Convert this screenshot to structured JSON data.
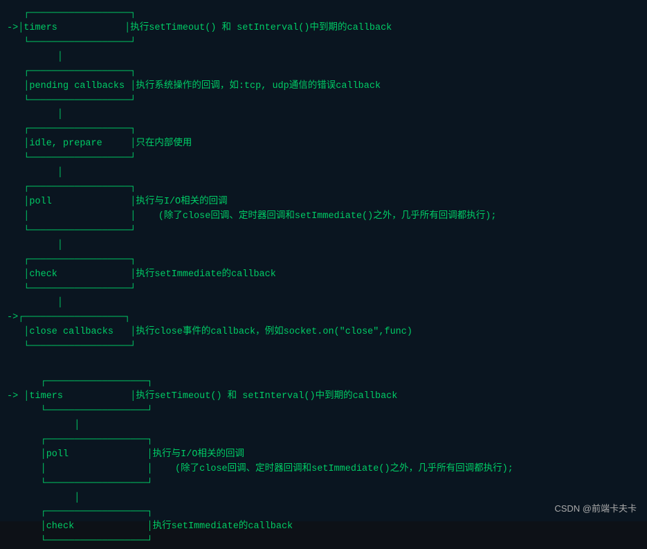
{
  "background_color": "#0a1520",
  "text_color": "#00cc66",
  "font": "Courier New",
  "watermark": "CSDN @前端卡夫卡",
  "section1": {
    "prompt": ">",
    "rows": [
      {
        "indent": "  ",
        "box_top": "┌─────────────────┐",
        "label": "",
        "desc": ""
      },
      {
        "indent": "->",
        "box_left": "│timers           │",
        "separator": "│",
        "desc": "执行setTimeout() 和 setInterval()中到期的callback"
      },
      {
        "indent": "  ",
        "box_bottom": "└─────────────────┘",
        "label": "",
        "desc": ""
      },
      {
        "indent": "  ",
        "spacer": "       │"
      },
      {
        "indent": "  ",
        "box_top": "┌─────────────────┐",
        "label": "",
        "desc": ""
      },
      {
        "indent": "  ",
        "box_left": "│pending callbacks│",
        "separator": "│",
        "desc": "执行系统操作的回调，如:tcp, udp通信的错误callback"
      },
      {
        "indent": "  ",
        "box_bottom": "└─────────────────┘",
        "label": "",
        "desc": ""
      },
      {
        "indent": "  ",
        "spacer": "       │"
      },
      {
        "indent": "  ",
        "box_top": "┌─────────────────┐",
        "label": "",
        "desc": ""
      },
      {
        "indent": "  ",
        "box_left": "│idle, prepare    │",
        "separator": "│",
        "desc": "只在内部使用"
      },
      {
        "indent": "  ",
        "box_bottom": "└─────────────────┘",
        "label": "",
        "desc": ""
      },
      {
        "indent": "  ",
        "spacer": "       │"
      },
      {
        "indent": "  ",
        "box_top": "┌─────────────────┐",
        "label": "",
        "desc": ""
      },
      {
        "indent": "  ",
        "box_left": "│poll             │",
        "separator": "│",
        "desc": "执行与I/O相关的回调"
      },
      {
        "indent": "  ",
        "box_cont": "│                 │",
        "desc2": "    (除了close回调、定时器回调和setImmediate()之外，几乎所有回调都执行);"
      },
      {
        "indent": "  ",
        "box_bottom": "└─────────────────┘",
        "label": "",
        "desc": ""
      },
      {
        "indent": "  ",
        "spacer": "       │"
      },
      {
        "indent": "  ",
        "box_top": "┌─────────────────┐",
        "label": "",
        "desc": ""
      },
      {
        "indent": "  ",
        "box_left": "│check            │",
        "separator": "│",
        "desc": "执行setImmediate的callback"
      },
      {
        "indent": "  ",
        "box_bottom": "└─────────────────┘",
        "label": "",
        "desc": ""
      },
      {
        "indent": "  ",
        "spacer": "       │"
      },
      {
        "indent": "->",
        "box_top": "┌─────────────────┐",
        "label": "",
        "desc": ""
      },
      {
        "indent": "  ",
        "box_left": "│close callbacks  │",
        "separator": "│",
        "desc": "执行close事件的callback，例如socket.on(\"close\",func)"
      },
      {
        "indent": "  ",
        "box_bottom": "└─────────────────┘",
        "label": "",
        "desc": ""
      }
    ]
  },
  "section2": {
    "rows": [
      {
        "type": "timers",
        "desc": "执行setTimeout() 和 setInterval()中到期的callback"
      },
      {
        "type": "poll",
        "desc": "执行与I/O相关的回调"
      },
      {
        "type": "poll_sub",
        "desc": "    (除了close回调、定时器回调和setImmediate()之外，几乎所有回调都执行);"
      },
      {
        "type": "check",
        "desc": "执行setImmediate的callback"
      }
    ]
  }
}
